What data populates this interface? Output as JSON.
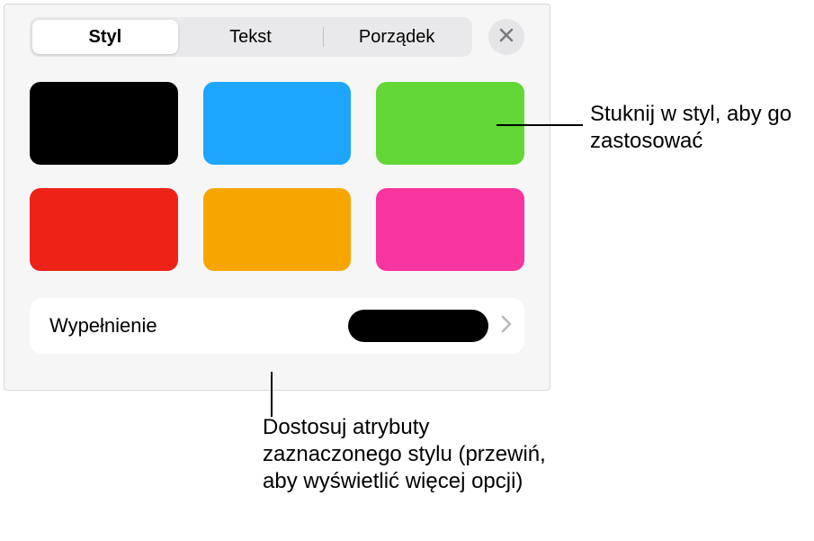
{
  "tabs": [
    "Styl",
    "Tekst",
    "Porządek"
  ],
  "active_tab_index": 0,
  "swatches": [
    {
      "name": "black",
      "color": "#000000"
    },
    {
      "name": "blue",
      "color": "#1ea6ff"
    },
    {
      "name": "green",
      "color": "#61d836"
    },
    {
      "name": "red",
      "color": "#ee2318"
    },
    {
      "name": "orange",
      "color": "#f7a600"
    },
    {
      "name": "pink",
      "color": "#f8349e"
    }
  ],
  "fill": {
    "label": "Wypełnienie",
    "current_color": "#000000"
  },
  "callouts": {
    "swatch": "Stuknij w styl, aby go zastosować",
    "fill": "Dostosuj atrybuty zaznaczonego stylu (przewiń, aby wyświetlić więcej opcji)"
  }
}
